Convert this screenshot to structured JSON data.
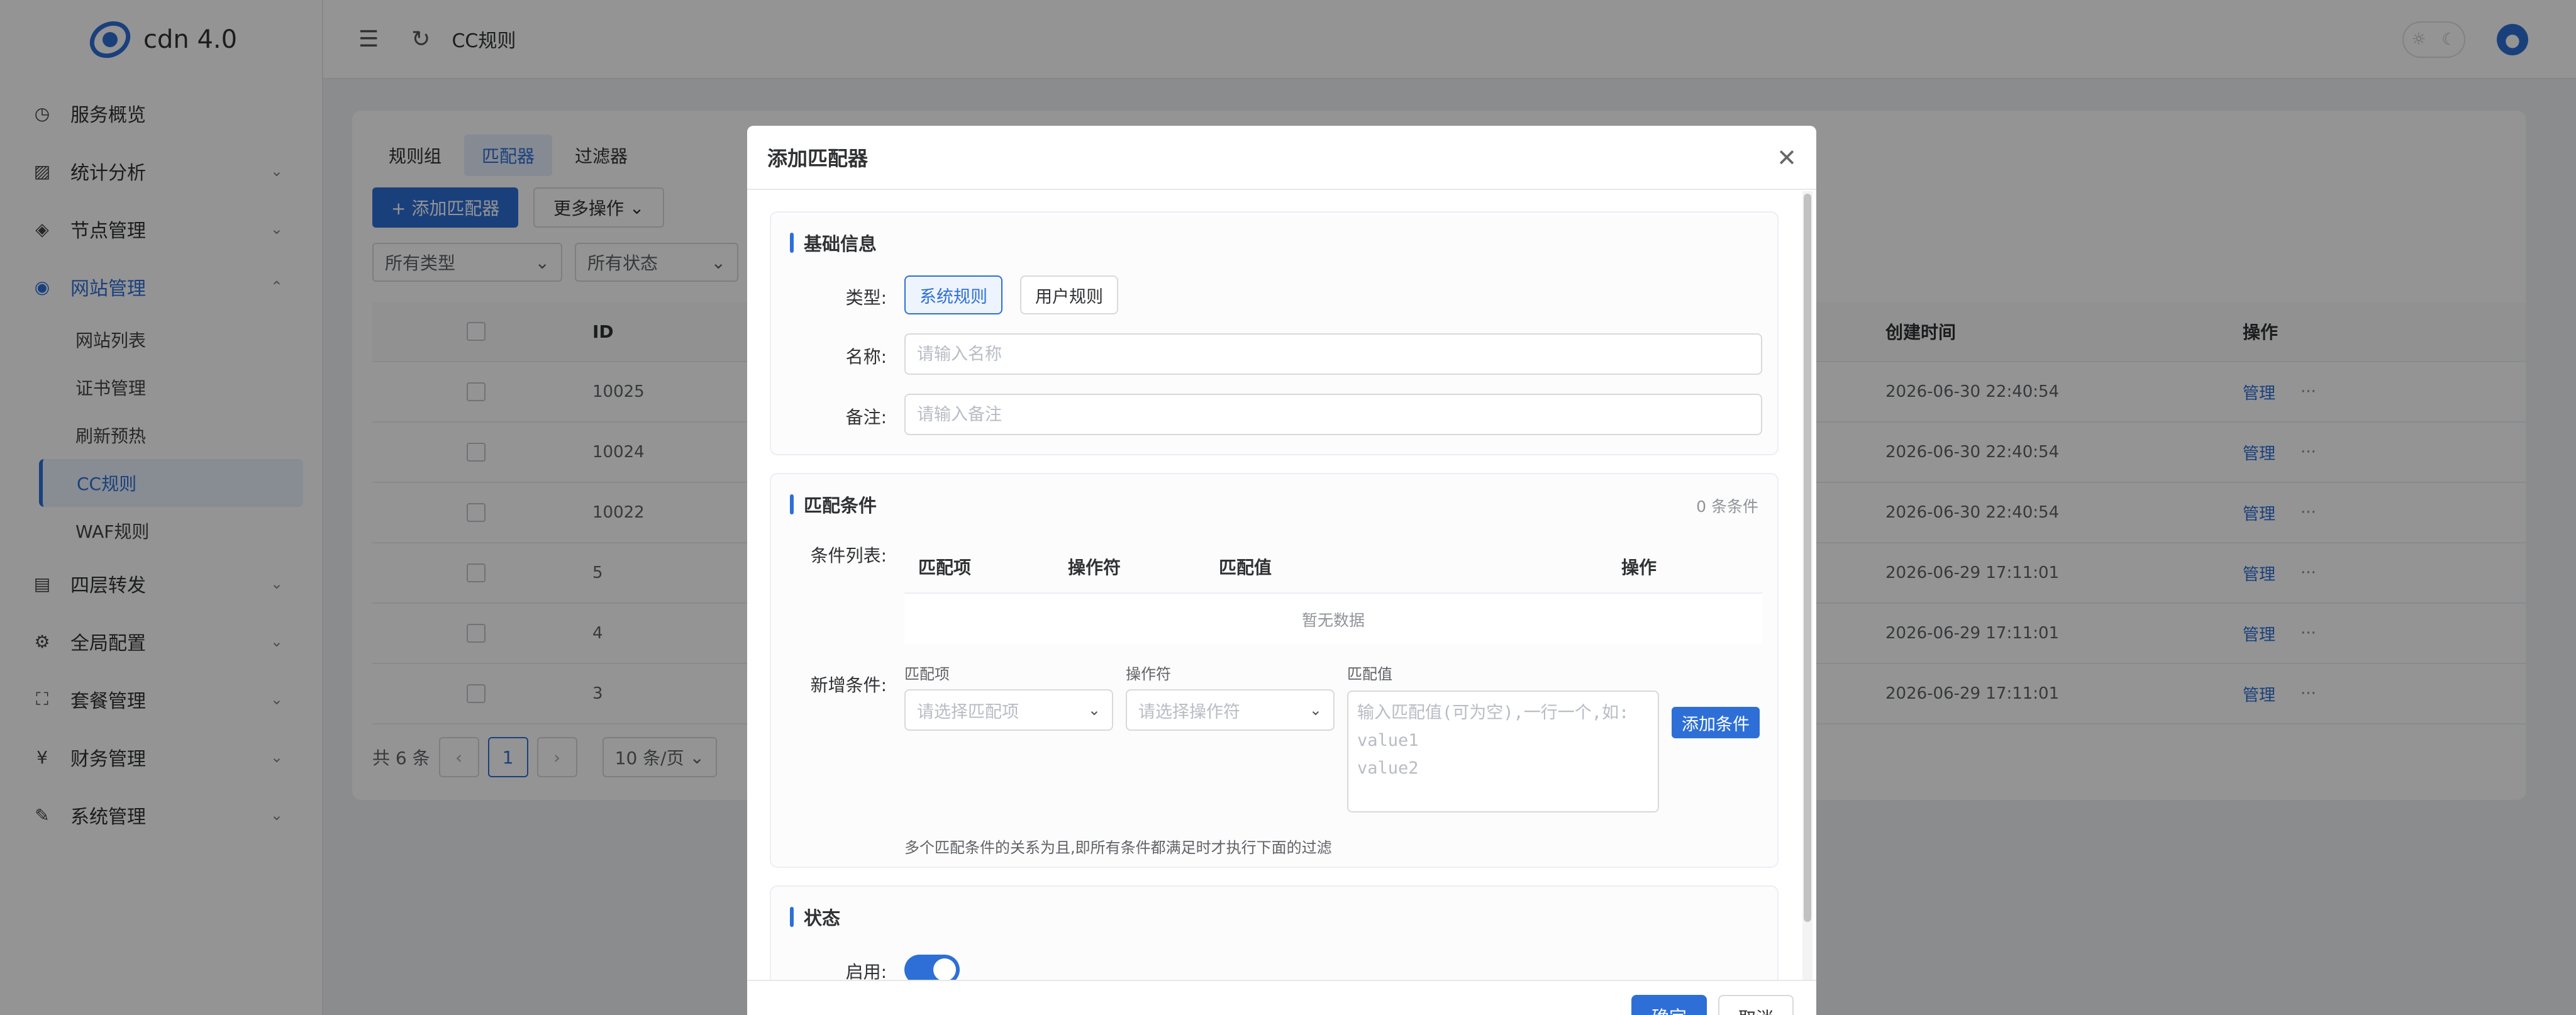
{
  "app": {
    "name": "cdn 4.0"
  },
  "sidebar": {
    "items": [
      {
        "label": "服务概览",
        "icon": "clock-icon"
      },
      {
        "label": "统计分析",
        "icon": "chart-icon"
      },
      {
        "label": "节点管理",
        "icon": "layers-icon"
      },
      {
        "label": "网站管理",
        "icon": "globe-icon"
      },
      {
        "label": "四层转发",
        "icon": "network-icon"
      },
      {
        "label": "全局配置",
        "icon": "gear-icon"
      },
      {
        "label": "套餐管理",
        "icon": "basket-icon"
      },
      {
        "label": "财务管理",
        "icon": "yen-icon"
      },
      {
        "label": "系统管理",
        "icon": "wrench-icon"
      }
    ],
    "website_sub": [
      "网站列表",
      "证书管理",
      "刷新预热",
      "CC规则",
      "WAF规则"
    ]
  },
  "topbar": {
    "breadcrumb": "CC规则"
  },
  "page": {
    "tabs": [
      "规则组",
      "匹配器",
      "过滤器"
    ],
    "add_button": "+ 添加匹配器",
    "more_button": "更多操作",
    "filter_type": "所有类型",
    "filter_status": "所有状态",
    "table": {
      "headers": {
        "id": "ID",
        "created": "创建时间",
        "action": "操作"
      },
      "rows": [
        {
          "id": "10025",
          "created": "2026-06-30 22:40:54",
          "action": "管理"
        },
        {
          "id": "10024",
          "created": "2026-06-30 22:40:54",
          "action": "管理"
        },
        {
          "id": "10022",
          "created": "2026-06-30 22:40:54",
          "action": "管理"
        },
        {
          "id": "5",
          "created": "2026-06-29 17:11:01",
          "action": "管理"
        },
        {
          "id": "4",
          "created": "2026-06-29 17:11:01",
          "action": "管理"
        },
        {
          "id": "3",
          "created": "2026-06-29 17:11:01",
          "action": "管理"
        }
      ],
      "more": "···"
    },
    "pager": {
      "total": "共 6 条",
      "current": "1",
      "size": "10 条/页"
    }
  },
  "modal": {
    "title": "添加匹配器",
    "basic": {
      "title": "基础信息",
      "type_label": "类型:",
      "type_options": [
        "系统规则",
        "用户规则"
      ],
      "name_label": "名称:",
      "name_placeholder": "请输入名称",
      "remark_label": "备注:",
      "remark_placeholder": "请输入备注"
    },
    "conditions": {
      "title": "匹配条件",
      "count": "0 条条件",
      "list_label": "条件列表:",
      "columns": [
        "匹配项",
        "操作符",
        "匹配值",
        "操作"
      ],
      "empty": "暂无数据",
      "new_label": "新增条件:",
      "item_label": "匹配项",
      "item_placeholder": "请选择匹配项",
      "op_label": "操作符",
      "op_placeholder": "请选择操作符",
      "value_label": "匹配值",
      "value_placeholder": "输入匹配值(可为空),一行一个,如:\nvalue1\nvalue2",
      "add_button": "添加条件",
      "hint": "多个匹配条件的关系为且,即所有条件都满足时才执行下面的过滤"
    },
    "status": {
      "title": "状态",
      "enable_label": "启用:"
    },
    "ok": "确定",
    "cancel": "取消"
  }
}
